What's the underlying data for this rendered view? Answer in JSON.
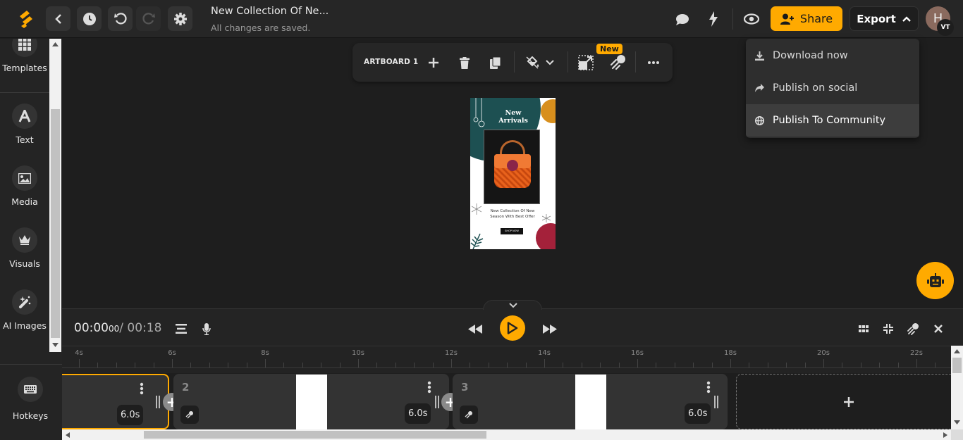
{
  "topbar": {
    "doc_title": "New Collection Of Ne...",
    "doc_status": "All changes are saved.",
    "share_label": "Share",
    "export_label": "Export",
    "avatar_initial": "H",
    "avatar_badge": "VT"
  },
  "colors": {
    "accent": "#ffaa00",
    "background": "#1e1e1e",
    "panel": "#262626"
  },
  "export_menu": {
    "items": [
      {
        "label": "Download now",
        "icon": "download-icon"
      },
      {
        "label": "Publish on social",
        "icon": "share-arrow-icon"
      },
      {
        "label": "Publish To Community",
        "icon": "globe-icon",
        "highlighted": true
      }
    ]
  },
  "sidebar": {
    "items": [
      {
        "label": "Templates",
        "icon": "grid-icon"
      },
      {
        "label": "Text",
        "icon": "text-icon"
      },
      {
        "label": "Media",
        "icon": "image-icon"
      },
      {
        "label": "Visuals",
        "icon": "crown-icon"
      },
      {
        "label": "AI Images",
        "icon": "magic-wand-icon"
      }
    ],
    "hotkeys_label": "Hotkeys"
  },
  "artboard_toolbar": {
    "label": "ARTBOARD 1",
    "new_badge": "New"
  },
  "artboard": {
    "title_line1": "New",
    "title_line2": "Arrivals",
    "description": "New Collection Of New Season With Best Offer",
    "cta": "SHOP NOW"
  },
  "player": {
    "current_time": "00:00",
    "current_frames": "00",
    "total_time": "/ 00:18"
  },
  "ruler": {
    "labels": [
      "4s",
      "6s",
      "8s",
      "10s",
      "12s",
      "14s",
      "16s",
      "18s",
      "20s",
      "22s"
    ]
  },
  "clips": [
    {
      "number": "",
      "duration": "6.0s",
      "selected": true
    },
    {
      "number": "2",
      "duration": "6.0s",
      "selected": false
    },
    {
      "number": "3",
      "duration": "6.0s",
      "selected": false
    }
  ],
  "add_clip_label": "+"
}
